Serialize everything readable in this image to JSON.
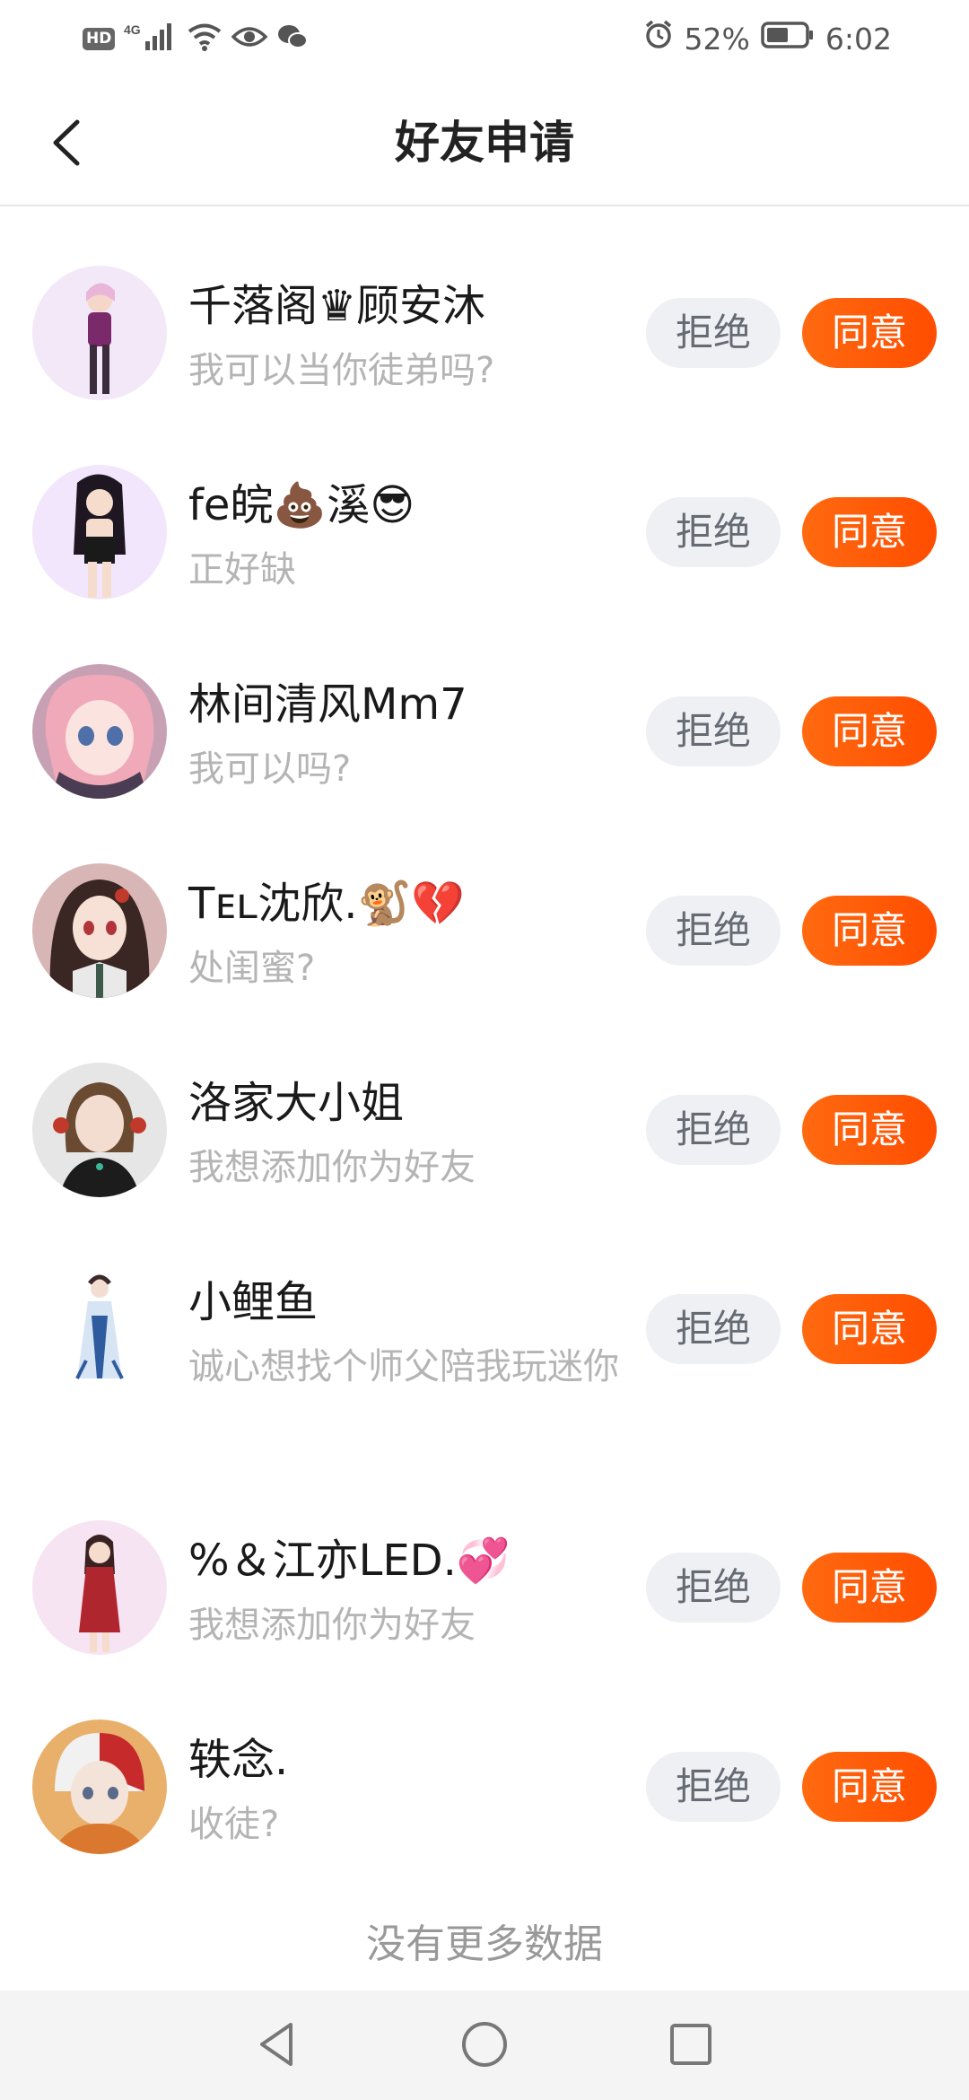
{
  "status_bar": {
    "hd": "HD",
    "network": "4G",
    "battery_percent": "52%",
    "time": "6:02",
    "icons": [
      "hd-icon",
      "signal-icon",
      "wifi-icon",
      "eye-icon",
      "wechat-icon",
      "alarm-icon",
      "battery-icon"
    ]
  },
  "header": {
    "title": "好友申请",
    "back_icon": "chevron-left-icon"
  },
  "requests": [
    {
      "name": "千落阁♛顾安沐",
      "message": "我可以当你徒弟吗?",
      "reject": "拒绝",
      "accept": "同意"
    },
    {
      "name": "fe皖💩溪😎",
      "message": "正好缺",
      "reject": "拒绝",
      "accept": "同意"
    },
    {
      "name": "林间清风Mm7",
      "message": "我可以吗?",
      "reject": "拒绝",
      "accept": "同意"
    },
    {
      "name": "Tᴇʟ沈欣.🐒💔",
      "message": "处闺蜜?",
      "reject": "拒绝",
      "accept": "同意"
    },
    {
      "name": "洛家大小姐",
      "message": "我想添加你为好友",
      "reject": "拒绝",
      "accept": "同意"
    },
    {
      "name": "小鲤鱼",
      "message": "诚心想找个师父陪我玩迷你",
      "reject": "拒绝",
      "accept": "同意"
    },
    {
      "name": "%＆江亦LED.💞",
      "message": "我想添加你为好友",
      "reject": "拒绝",
      "accept": "同意"
    },
    {
      "name": "轶念.",
      "message": "收徒?",
      "reject": "拒绝",
      "accept": "同意"
    }
  ],
  "footer": {
    "no_more": "没有更多数据"
  },
  "nav_bar": {
    "icons": [
      "back-triangle-icon",
      "home-circle-icon",
      "recents-square-icon"
    ]
  },
  "colors": {
    "accent": "#ff5a0a",
    "reject_bg": "#eef0f4",
    "secondary_text": "#b4b4b4"
  }
}
